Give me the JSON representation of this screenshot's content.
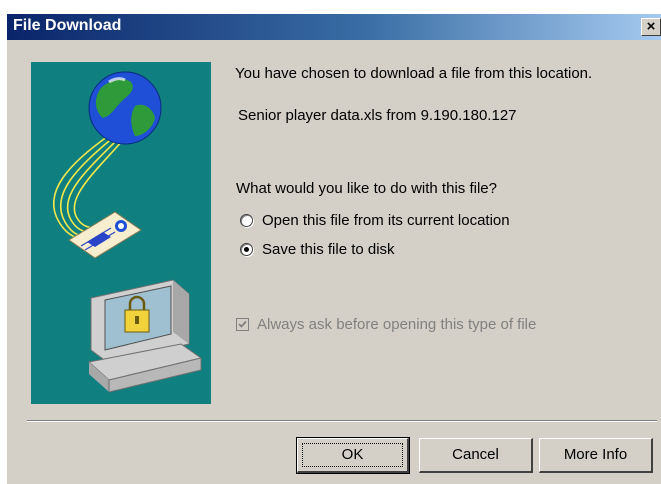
{
  "window": {
    "title": "File Download",
    "close_glyph": "×"
  },
  "colors": {
    "titlebar_start": "#0a246a",
    "titlebar_end": "#a6caf0",
    "illustration_bg": "#0f7f7f",
    "dialog_bg": "#d4d0c8"
  },
  "illustration": {
    "icons": [
      "globe-icon",
      "document-icon",
      "computer-lock-icon"
    ]
  },
  "message": {
    "intro": "You have chosen to download a file from this location.",
    "file_info": "Senior player data.xls from 9.190.180.127",
    "question": "What would you like to do with this file?"
  },
  "options": {
    "open": {
      "label": "Open this file from its current location",
      "selected": false
    },
    "save": {
      "label": "Save this file to disk",
      "selected": true
    }
  },
  "always_ask": {
    "label": "Always ask before opening this type of file",
    "checked": true,
    "disabled": true
  },
  "buttons": {
    "ok": "OK",
    "cancel": "Cancel",
    "more_info": "More Info"
  }
}
